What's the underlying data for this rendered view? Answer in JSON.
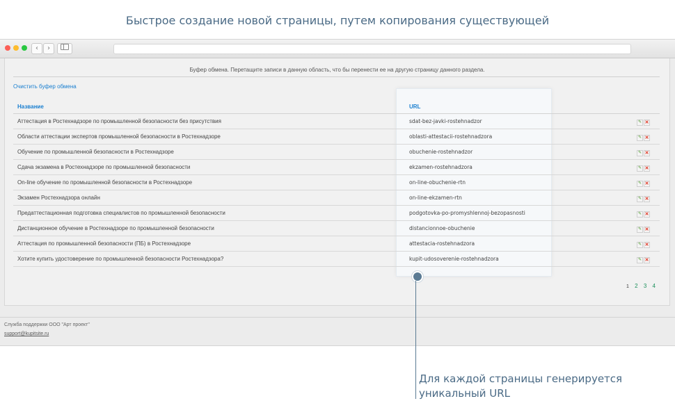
{
  "page_title": "Быстрое создание новой страницы, путем копирования существующей",
  "browser": {
    "back_icon": "‹",
    "forward_icon": "›"
  },
  "buffer": {
    "text": "Буфер обмена. Перетащите записи в данную область, что бы перенести ее на другую страницу данного раздела.",
    "clear_link": "Очистить буфер обмена"
  },
  "table": {
    "headers": {
      "name": "Название",
      "url": "URL"
    },
    "rows": [
      {
        "name": "Аттестация в Ростехнадзоре по промышленной безопасности без присутствия",
        "url": "sdat-bez-javki-rostehnadzor"
      },
      {
        "name": "Области аттестации экспертов промышленной безопасности в Ростехнадзоре",
        "url": "oblasti-attestacii-rostehnadzora"
      },
      {
        "name": "Обучение по промышленной безопасности в Ростехнадзоре",
        "url": "obuchenie-rostehnadzor"
      },
      {
        "name": "Сдача экзамена в Ростехнадзоре по промышленной безопасности",
        "url": "ekzamen-rostehnadzora"
      },
      {
        "name": "On-line обучение по промышленной безопасности в Ростехнадзоре",
        "url": "on-line-obuchenie-rtn"
      },
      {
        "name": "Экзамен Ростехнадзора онлайн",
        "url": "on-line-ekzamen-rtn"
      },
      {
        "name": "Предаттестационная подготовка специалистов по промышленной безопасности",
        "url": "podgotovka-po-promyshlennoj-bezopasnosti"
      },
      {
        "name": "Дистанционное обучение в Ростехнадзоре по промышленной безопасности",
        "url": "distancionnoe-obuchenie"
      },
      {
        "name": "Аттестация по промышленной безопасности (ПБ) в Ростехнадзоре",
        "url": "attestacia-rostehnadzora"
      },
      {
        "name": "Хотите купить удостоверение по промышленной безопасности Ростехнадзора?",
        "url": "kupit-udosoverenie-rostehnadzora"
      }
    ],
    "edit_icon": "edit-pencil-icon",
    "delete_icon": "delete-x-icon"
  },
  "pagination": {
    "pages": [
      "1",
      "2",
      "3",
      "4"
    ],
    "current": "1"
  },
  "footer": {
    "support_text": "Служба поддержки ООО \"Арт проект\"",
    "email": "support@kupitsite.ru"
  },
  "callout": {
    "text": "Для каждой страницы генерируется уникальный URL"
  },
  "colors": {
    "accent": "#1a7fd0",
    "annotation": "#4a6a85",
    "page_link": "#1a8f5a"
  }
}
